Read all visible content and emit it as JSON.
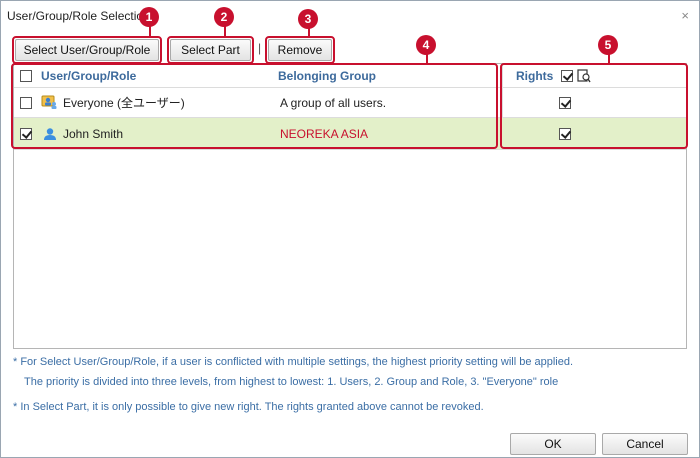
{
  "window": {
    "title": "User/Group/Role Selection",
    "close_glyph": "×"
  },
  "toolbar": {
    "select_user_label": "Select User/Group/Role",
    "select_part_label": "Select Part",
    "separator": "|",
    "remove_label": "Remove"
  },
  "callouts": [
    "1",
    "2",
    "3",
    "4",
    "5"
  ],
  "grid": {
    "headers": {
      "name": "User/Group/Role",
      "group": "Belonging Group",
      "rights": "Rights"
    },
    "rows": [
      {
        "name": "Everyone (全ユーザー)",
        "group": "A group of all users.",
        "icon": "group-icon",
        "checked": false,
        "rights": true,
        "selected": false
      },
      {
        "name": "John Smith",
        "group": "NEOREKA ASIA",
        "icon": "user-icon",
        "checked": true,
        "rights": true,
        "selected": true
      }
    ]
  },
  "notes": {
    "line1": "* For Select User/Group/Role, if a user is conflicted with multiple settings, the highest priority setting will be applied.",
    "line2": "The priority is divided into three levels, from highest to lowest: 1. Users, 2. Group and Role, 3. \"Everyone\" role",
    "line3": "* In Select Part, it is only possible to give new right. The rights granted above cannot be revoked."
  },
  "footer": {
    "ok_label": "OK",
    "cancel_label": "Cancel"
  },
  "colors": {
    "accent_red": "#c8102e",
    "header_blue": "#3d6a9c",
    "note_blue": "#3b6ea5",
    "selected_row": "#e3f0c9",
    "group_text_red": "#c8102e"
  }
}
